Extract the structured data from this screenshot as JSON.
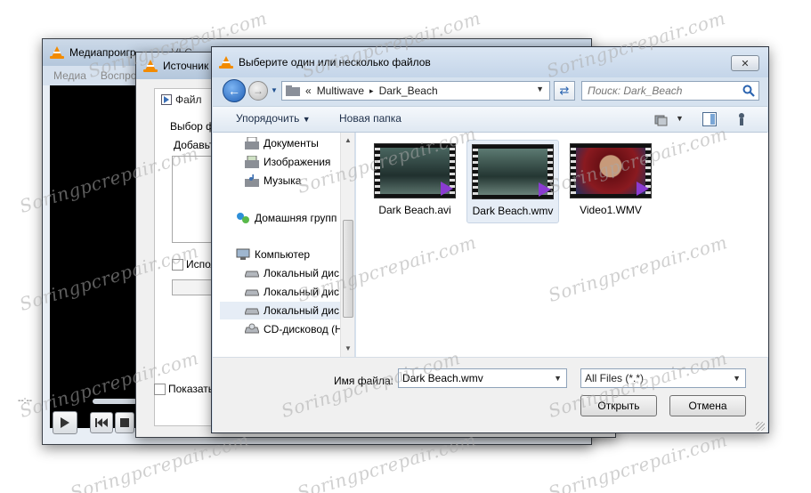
{
  "vlc": {
    "title": "Медиапроигр",
    "title_tail": "VLC",
    "menu": [
      "Медиа",
      "Воспро"
    ],
    "time": "--:--"
  },
  "source": {
    "title": "Источник",
    "tab_label": "Файл",
    "select_label": "Выбор фа",
    "add_label": "Добавьте",
    "use_label": "Исполь",
    "show_label": "Показать"
  },
  "filedlg": {
    "title": "Выберите один или несколько файлов",
    "close_symbol": "✕",
    "address": {
      "prefix": "«",
      "parts": [
        "Multiwave",
        "Dark_Beach"
      ],
      "separator": "▸"
    },
    "search_placeholder": "Поиск: Dark_Beach",
    "toolbar": {
      "organize_label": "Упорядочить",
      "new_folder_label": "Новая папка"
    },
    "nav_items": [
      {
        "label": "Документы",
        "icon": "documents-icon"
      },
      {
        "label": "Изображения",
        "icon": "pictures-icon"
      },
      {
        "label": "Музыка",
        "icon": "music-icon"
      },
      {
        "label": "Домашняя групп",
        "icon": "homegroup-icon"
      },
      {
        "label": "Компьютер",
        "icon": "computer-icon"
      },
      {
        "label": "Локальный дис",
        "icon": "drive-icon"
      },
      {
        "label": "Локальный дис",
        "icon": "drive-icon"
      },
      {
        "label": "Локальный дис",
        "icon": "drive-icon"
      },
      {
        "label": "CD-дисковод (H",
        "icon": "cd-drive-icon"
      }
    ],
    "files": [
      {
        "name": "Dark Beach.avi",
        "selected": false
      },
      {
        "name": "Dark Beach.wmv",
        "selected": true
      },
      {
        "name": "Video1.WMV",
        "selected": false
      }
    ],
    "filename_label": "Имя файла:",
    "filename_value": "Dark Beach.wmv",
    "filter_value": "All Files (*.*)",
    "open_label": "Открыть",
    "cancel_label": "Отмена"
  },
  "watermark": "Soringpcrepair.com",
  "colors": {
    "vlc_orange": "#f28b00",
    "selection": "#e6edf6",
    "back_button": "#1f5fb6",
    "video_badge": "#8a3bd1"
  }
}
